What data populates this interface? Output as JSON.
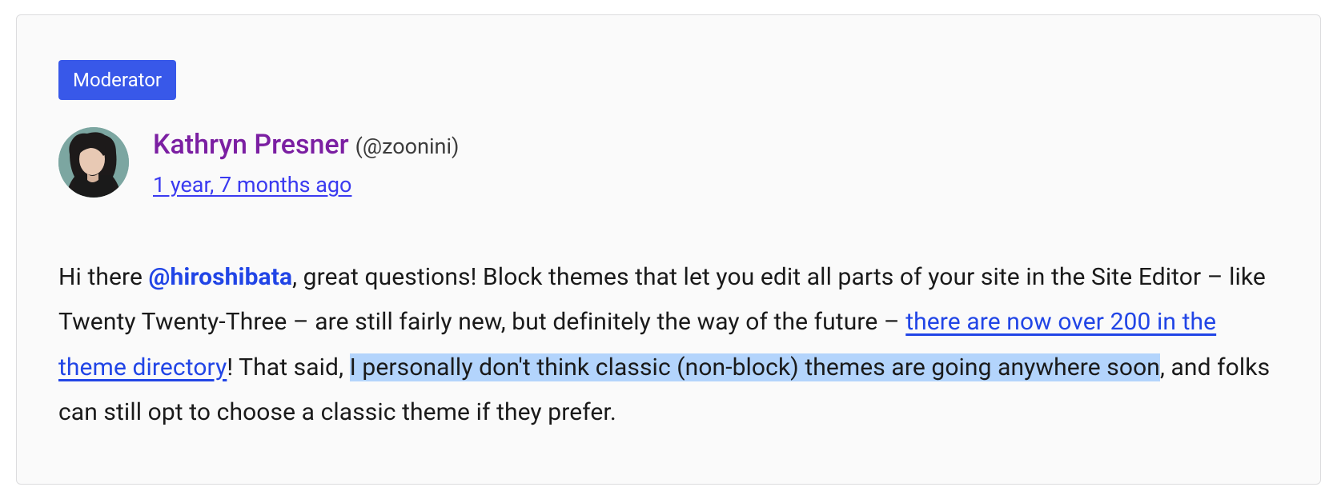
{
  "badge": {
    "label": "Moderator"
  },
  "author": {
    "name": "Kathryn Presner",
    "handle": "(@zoonini)",
    "timestamp": "1 year, 7 months ago"
  },
  "body": {
    "t1": "Hi there ",
    "mention": "@hiroshibata",
    "t2": ", great questions! Block themes that let you edit all parts of your site in the Site Editor – like Twenty Twenty-Three – are still fairly new, but definitely the way of the future – ",
    "link": "there are now over 200 in the theme directory",
    "t3": "! That said, ",
    "highlight": "I personally don't think classic (non-block) themes are going anywhere soon",
    "t4": ", and folks can still opt to choose a classic theme if they prefer."
  }
}
